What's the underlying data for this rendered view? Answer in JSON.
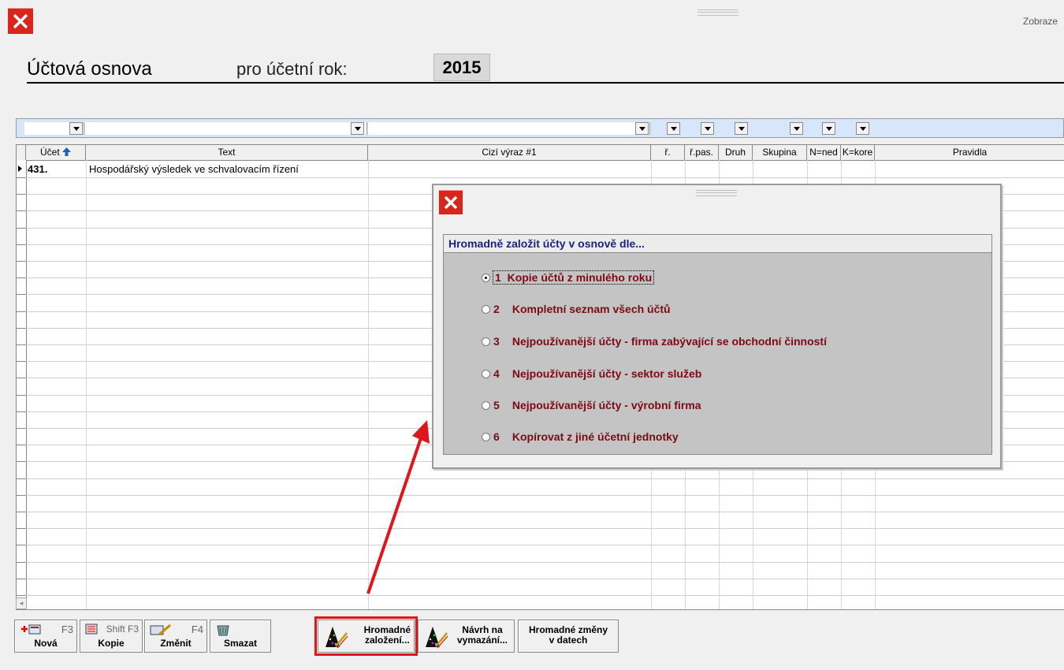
{
  "window": {
    "close_icon": "close-x-icon",
    "top_right_label": "Zobraze"
  },
  "header": {
    "title": "Účtová osnova",
    "year_label": "pro účetní rok:",
    "year_value": "2015"
  },
  "grid": {
    "columns": [
      "Účet",
      "Text",
      "Cizí výraz #1",
      "ř.",
      "ř.pas.",
      "Druh",
      "Skupina",
      "N=ned",
      "K=kore",
      "Pravidla"
    ],
    "sort_icon": "arrow-up-icon",
    "rows": [
      {
        "account": "431.",
        "text": "Hospodářský výsledek ve schvalovacím řízení"
      }
    ]
  },
  "dialog": {
    "close_icon": "close-x-icon",
    "heading": "Hromadně založit účty v osnově dle...",
    "selected_option": 1,
    "options": [
      {
        "num": "1",
        "label": "Kopie účtů z minulého roku"
      },
      {
        "num": "2",
        "label": "Kompletní seznam všech účtů"
      },
      {
        "num": "3",
        "label": "Nejpoužívanější účty - firma zabývající se obchodní činností"
      },
      {
        "num": "4",
        "label": "Nejpoužívanější účty - sektor služeb"
      },
      {
        "num": "5",
        "label": "Nejpoužívanější účty - výrobní firma"
      },
      {
        "num": "6",
        "label": "Kopírovat z jiné účetní jednotky"
      }
    ]
  },
  "toolbar": {
    "new": {
      "label": "Nová",
      "key": "F3"
    },
    "copy": {
      "label": "Kopie",
      "key": "Shift F3"
    },
    "edit": {
      "label": "Změnit",
      "key": "F4"
    },
    "delete": {
      "label": "Smazat"
    },
    "bulk_create": {
      "line1": "Hromadné",
      "line2": "založení..."
    },
    "propose_delete": {
      "line1": "Návrh na",
      "line2": "vymazání..."
    },
    "bulk_changes": {
      "line1": "Hromadné změny",
      "line2": "v datech"
    }
  },
  "colors": {
    "close_red": "#d9251c",
    "filter_bg": "#d7e6fb",
    "option_text": "#7b0a14",
    "heading_text": "#1a237e",
    "highlight_red": "#e0161a"
  }
}
